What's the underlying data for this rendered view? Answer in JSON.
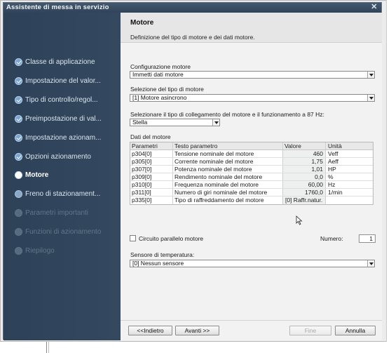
{
  "window": {
    "title": "Assistente di messa in servizio"
  },
  "sidebar": {
    "items": [
      {
        "label": "Classe di applicazione",
        "state": "done"
      },
      {
        "label": "Impostazione del valor...",
        "state": "done"
      },
      {
        "label": "Tipo di controllo/regol...",
        "state": "done"
      },
      {
        "label": "Preimpostazione di val...",
        "state": "done"
      },
      {
        "label": "Impostazione azionam...",
        "state": "done"
      },
      {
        "label": "Opzioni azionamento",
        "state": "done"
      },
      {
        "label": "Motore",
        "state": "current"
      },
      {
        "label": "Freno di stazionament...",
        "state": "pending"
      },
      {
        "label": "Parametri importanti",
        "state": "disabled"
      },
      {
        "label": "Funzioni di azionamento",
        "state": "disabled"
      },
      {
        "label": "Riepilogo",
        "state": "disabled"
      }
    ]
  },
  "header": {
    "title": "Motore",
    "subtitle": "Definizione del tipo di motore e dei dati motore."
  },
  "form": {
    "config_label": "Configurazione motore",
    "config_value": "Immetti dati motore",
    "type_label": "Selezione del tipo di motore",
    "type_value": "[1] Motore asincrono",
    "connection_label": "Selezionare il tipo di collegamento del motore e il funzionamento a 87 Hz:",
    "connection_value": "Stella",
    "data_label": "Dati del motore"
  },
  "table": {
    "headers": [
      "Parametri",
      "Testo parametro",
      "Valore",
      "Unità"
    ],
    "rows": [
      {
        "param": "p304[0]",
        "text": "Tensione nominale del motore",
        "value": "460",
        "unit": "Veff"
      },
      {
        "param": "p305[0]",
        "text": "Corrente nominale del motore",
        "value": "1,75",
        "unit": "Aeff"
      },
      {
        "param": "p307[0]",
        "text": "Potenza nominale del motore",
        "value": "1,01",
        "unit": "HP"
      },
      {
        "param": "p309[0]",
        "text": "Rendimento nominale del motore",
        "value": "0,0",
        "unit": "%"
      },
      {
        "param": "p310[0]",
        "text": "Frequenza nominale del motore",
        "value": "60,00",
        "unit": "Hz"
      },
      {
        "param": "p311[0]",
        "text": "Numero di giri nominale del motore",
        "value": "1760,0",
        "unit": "1/min"
      },
      {
        "param": "p335[0]",
        "text": "Tipo di raffreddamento del motore",
        "value": "[0] Raffr.natur.",
        "unit": ""
      }
    ]
  },
  "parallel": {
    "label": "Circuito parallelo motore",
    "number_label": "Numero:",
    "number_value": "1"
  },
  "sensor": {
    "label": "Sensore di temperatura:",
    "value": "[0] Nessun sensore"
  },
  "buttons": {
    "back": "<<Indietro",
    "next": "Avanti >>",
    "finish": "Fine",
    "cancel": "Annulla"
  },
  "colors": {
    "sidebar": "#2d4258",
    "titlebar": "#30435a",
    "content": "#f2f2f2",
    "check": "#7ba6d3"
  }
}
